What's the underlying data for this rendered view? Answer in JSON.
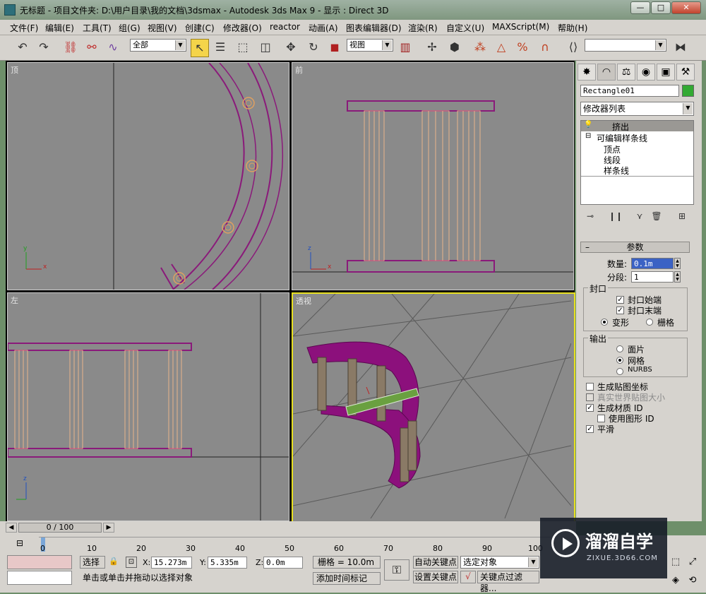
{
  "titlebar": {
    "text": "无标题    - 项目文件夹: D:\\用户目录\\我的文档\\3dsmax     - Autodesk 3ds Max 9       - 显示 : Direct 3D",
    "minimize": "—",
    "maximize": "□",
    "close": "✕"
  },
  "menu": {
    "items": [
      "文件(F)",
      "编辑(E)",
      "工具(T)",
      "组(G)",
      "视图(V)",
      "创建(C)",
      "修改器(O)",
      "reactor",
      "动画(A)",
      "图表编辑器(D)",
      "渲染(R)",
      "自定义(U)",
      "MAXScript(M)",
      "帮助(H)"
    ]
  },
  "toolbar": {
    "selection_filter": "全部",
    "ref_coord": "视图"
  },
  "viewports": {
    "top": "顶",
    "front": "前",
    "left": "左",
    "perspective": "透视",
    "axis_x": "x",
    "axis_y": "y",
    "axis_z": "z"
  },
  "command_panel": {
    "object_name": "Rectangle01",
    "object_color": "#33aa33",
    "modifier_list": "修改器列表",
    "stack": {
      "extrude": "挤出",
      "editable_spline": "可编辑样条线",
      "vertex": "顶点",
      "segment": "线段",
      "spline": "样条线"
    },
    "params": {
      "rollout_title": "参数",
      "amount_label": "数量:",
      "amount_value": "0.1m",
      "segments_label": "分段:",
      "segments_value": "1",
      "capping": {
        "title": "封口",
        "cap_start": "封口始端",
        "cap_end": "封口末端",
        "morph": "变形",
        "grid": "栅格"
      },
      "output": {
        "title": "输出",
        "patch": "面片",
        "mesh": "网格",
        "nurbs": "NURBS"
      },
      "gen_mapping": "生成贴图坐标",
      "real_world": "真实世界贴图大小",
      "gen_mat_id": "生成材质 ID",
      "use_shape_id": "使用图形 ID",
      "smooth": "平滑"
    }
  },
  "timeline": {
    "frame": "0 / 100",
    "ticks": [
      "0",
      "10",
      "20",
      "30",
      "40",
      "50",
      "60",
      "70",
      "80",
      "90",
      "100"
    ]
  },
  "status": {
    "select_label": "选择",
    "x_label": "X:",
    "x_value": "15.273m",
    "y_label": "Y:",
    "y_value": "5.335m",
    "z_label": "Z:",
    "z_value": "0.0m",
    "grid": "栅格 = 10.0m",
    "auto_key": "自动关键点",
    "set_key": "设置关键点",
    "key_mode": "选定对象",
    "key_filters": "关键点过滤器...",
    "prompt": "单击或单击并拖动以选择对象",
    "add_time_tag": "添加时间标记"
  },
  "watermark": {
    "brand": "溜溜自学",
    "url": "ZIXUE.3D66.COM"
  }
}
